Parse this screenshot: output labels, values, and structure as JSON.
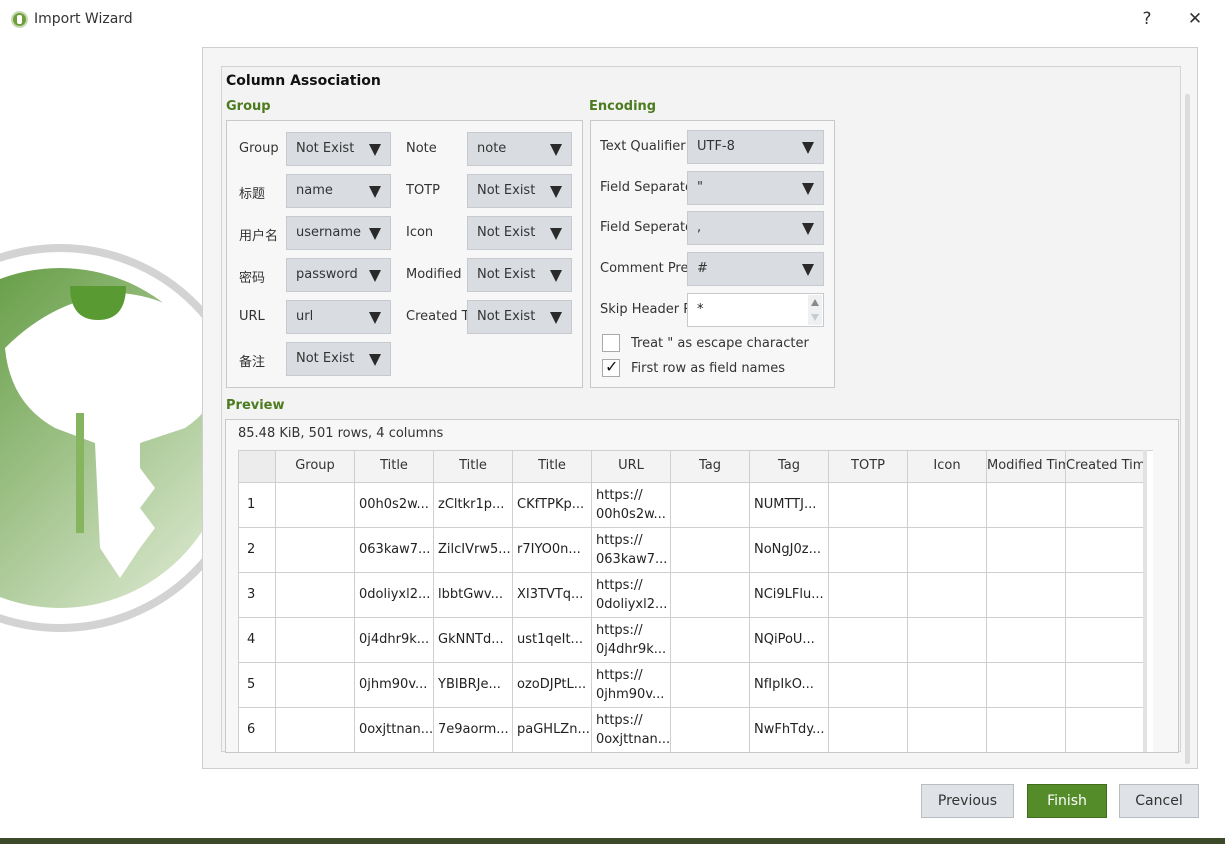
{
  "window": {
    "title": "Import Wizard",
    "help_label": "?",
    "close_label": "✕"
  },
  "page": {
    "section_title": "Column Association",
    "group_title": "Group",
    "encoding_title": "Encoding",
    "preview_title": "Preview"
  },
  "group": {
    "left": [
      {
        "label": "Group",
        "value": "Not Exist"
      },
      {
        "label": "标题",
        "value": "name"
      },
      {
        "label": "用户名",
        "value": "username"
      },
      {
        "label": "密码",
        "value": "password"
      },
      {
        "label": "URL",
        "value": "url"
      },
      {
        "label": "备注",
        "value": "Not Exist"
      }
    ],
    "right": [
      {
        "label": "Note",
        "value": "note"
      },
      {
        "label": "TOTP",
        "value": "Not Exist"
      },
      {
        "label": "Icon",
        "value": "Not Exist"
      },
      {
        "label": "Modified",
        "value": "Not Exist"
      },
      {
        "label": "Created Ti",
        "value": "Not Exist"
      }
    ]
  },
  "encoding": {
    "rows": [
      {
        "label": "Text Qualifier",
        "value": "UTF-8"
      },
      {
        "label": "Field Separator",
        "value": "\""
      },
      {
        "label": "Field Seperator",
        "value": ","
      },
      {
        "label": "Comment Prefix",
        "value": "#"
      }
    ],
    "skip_label": "Skip Header Ro",
    "skip_value": "*",
    "escape_label": "Treat \" as escape character",
    "escape_checked": false,
    "firstrow_label": "First row as field names",
    "firstrow_checked": true
  },
  "preview": {
    "summary": "85.48 KiB, 501 rows, 4 columns",
    "columns": [
      "Group",
      "Title",
      "Title",
      "Title",
      "URL",
      "Tag",
      "Tag",
      "TOTP",
      "Icon",
      "Modified Time",
      "Created Time"
    ],
    "rows": [
      {
        "num": "1",
        "cells": [
          "",
          "00h0s2w...",
          "zCltkr1p...",
          "CKfTPKp...",
          "https://\n00h0s2w...",
          "",
          "NUMTTJ...",
          "",
          "",
          "",
          ""
        ]
      },
      {
        "num": "2",
        "cells": [
          "",
          "063kaw7...",
          "ZilcIVrw5...",
          "r7IYO0n...",
          "https://\n063kaw7...",
          "",
          "NoNgJ0z...",
          "",
          "",
          "",
          ""
        ]
      },
      {
        "num": "3",
        "cells": [
          "",
          "0doliyxl2...",
          "lbbtGwv...",
          "XI3TVTq...",
          "https://\n0doliyxl2...",
          "",
          "NCi9LFlu...",
          "",
          "",
          "",
          ""
        ]
      },
      {
        "num": "4",
        "cells": [
          "",
          "0j4dhr9k...",
          "GkNNTd...",
          "ust1qeIt...",
          "https://\n0j4dhr9k...",
          "",
          "NQiPoU...",
          "",
          "",
          "",
          ""
        ]
      },
      {
        "num": "5",
        "cells": [
          "",
          "0jhm90v...",
          "YBIBRJe...",
          "ozoDJPtL...",
          "https://\n0jhm90v...",
          "",
          "NfIpIkO...",
          "",
          "",
          "",
          ""
        ]
      },
      {
        "num": "6",
        "cells": [
          "",
          "0oxjttnan...",
          "7e9aorm...",
          "paGHLZn...",
          "https://\n0oxjttnan...",
          "",
          "NwFhTdy...",
          "",
          "",
          "",
          ""
        ]
      }
    ]
  },
  "buttons": {
    "previous": "Previous",
    "finish": "Finish",
    "cancel": "Cancel"
  }
}
